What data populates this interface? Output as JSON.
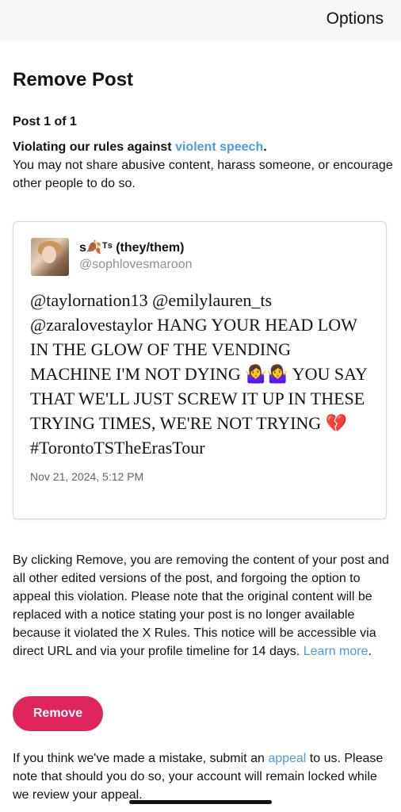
{
  "header": {
    "options_label": "Options"
  },
  "page": {
    "title": "Remove Post",
    "post_count": "Post 1 of 1",
    "violation_prefix": "Violating our rules against ",
    "violation_link": "violent speech",
    "violation_suffix": ".",
    "violation_description": "You may not share abusive content, harass someone, or encourage other people to do so."
  },
  "post": {
    "display_name": "s🍂ᵀˢ (they/them)",
    "handle": "@sophlovesmaroon",
    "text": "@taylornation13 @emilylauren_ts @zaralovestaylor HANG YOUR HEAD LOW IN THE GLOW OF THE VENDING MACHINE I'M NOT DYING 🤷‍♀️🤷‍♀️ YOU SAY THAT WE'LL JUST SCREW IT UP IN THESE TRYING TIMES, WE'RE NOT TRYING 💔 #TorontoTSTheErasTour",
    "timestamp": "Nov 21, 2024, 5:12 PM"
  },
  "info": {
    "text": "By clicking Remove, you are removing the content of your post and all other edited versions of the post, and forgoing the option to appeal this violation. Please note that the original content will be replaced with a notice stating your post is no longer available because it violated the X Rules. This notice will be accessible via direct URL and via your profile timeline for 14 days. ",
    "learn_more": "Learn more",
    "after_link": "."
  },
  "actions": {
    "remove_label": "Remove"
  },
  "appeal": {
    "prefix": "If you think we've made a mistake, submit an ",
    "link": "appeal",
    "suffix": " to us. Please note that should you do so, your account will remain locked while we review your appeal."
  },
  "colors": {
    "accent_link": "#4a9de0",
    "remove_button": "#e0245e"
  }
}
